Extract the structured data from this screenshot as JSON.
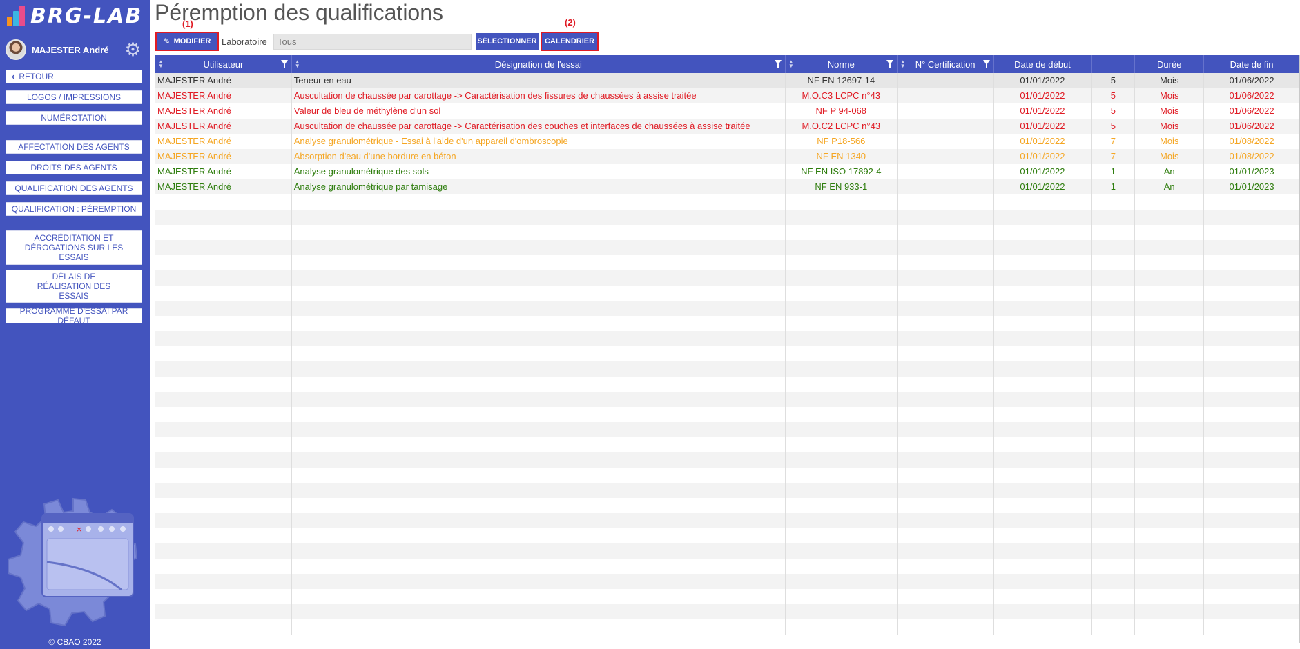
{
  "app": {
    "logo_text": "BRG-LAB",
    "copyright": "© CBAO 2022"
  },
  "colors": {
    "primary": "#4354be",
    "expired": "#e01b24",
    "warning": "#f5a623",
    "valid": "#2e7d0d",
    "callout": "#e01b24"
  },
  "user": {
    "name": "MAJESTER André"
  },
  "sidebar": {
    "back_label": "RETOUR",
    "items": [
      {
        "label": "LOGOS / IMPRESSIONS"
      },
      {
        "label": "NUMÉROTATION"
      },
      {
        "label": "AFFECTATION DES AGENTS"
      },
      {
        "label": "DROITS DES AGENTS"
      },
      {
        "label": "QUALIFICATION DES AGENTS"
      },
      {
        "label": "QUALIFICATION : PÉREMPTION"
      },
      {
        "label": "ACCRÉDITATION ET DÉROGATIONS SUR LES ESSAIS"
      },
      {
        "label": "DÉLAIS DE RÉALISATION DES ESSAIS"
      },
      {
        "label": "PROGRAMME D'ESSAI PAR DÉFAUT"
      }
    ]
  },
  "page": {
    "title": "Péremption des qualifications"
  },
  "toolbar": {
    "callout_1": "(1)",
    "callout_2": "(2)",
    "modify_label": "MODIFIER",
    "laboratory_label": "Laboratoire",
    "laboratory_placeholder": "Tous",
    "select_label": "SÉLECTIONNER",
    "calendar_label": "CALENDRIER"
  },
  "table": {
    "columns": [
      "Utilisateur",
      "Désignation de l'essai",
      "Norme",
      "N° Certification",
      "Date de début",
      "",
      "Durée",
      "Date de fin"
    ],
    "rows": [
      {
        "user": "MAJESTER André",
        "test": "Teneur en eau",
        "norm": "NF EN 12697-14",
        "cert": "",
        "start": "01/01/2022",
        "n": "5",
        "unit": "Mois",
        "end": "01/06/2022",
        "status": "gray"
      },
      {
        "user": "MAJESTER André",
        "test": "Auscultation de chaussée par carottage -> Caractérisation des fissures de chaussées à assise traitée",
        "norm": "M.O.C3 LCPC n°43",
        "cert": "",
        "start": "01/01/2022",
        "n": "5",
        "unit": "Mois",
        "end": "01/06/2022",
        "status": "red"
      },
      {
        "user": "MAJESTER André",
        "test": "Valeur de bleu de méthylène d'un sol",
        "norm": "NF P 94-068",
        "cert": "",
        "start": "01/01/2022",
        "n": "5",
        "unit": "Mois",
        "end": "01/06/2022",
        "status": "red"
      },
      {
        "user": "MAJESTER André",
        "test": "Auscultation de chaussée par carottage -> Caractérisation des couches et interfaces de chaussées à assise traitée",
        "norm": "M.O.C2 LCPC n°43",
        "cert": "",
        "start": "01/01/2022",
        "n": "5",
        "unit": "Mois",
        "end": "01/06/2022",
        "status": "red"
      },
      {
        "user": "MAJESTER André",
        "test": "Analyse granulométrique - Essai à l'aide d'un appareil d'ombroscopie",
        "norm": "NF P18-566",
        "cert": "",
        "start": "01/01/2022",
        "n": "7",
        "unit": "Mois",
        "end": "01/08/2022",
        "status": "orange"
      },
      {
        "user": "MAJESTER André",
        "test": "Absorption d'eau d'une bordure en béton",
        "norm": "NF EN 1340",
        "cert": "",
        "start": "01/01/2022",
        "n": "7",
        "unit": "Mois",
        "end": "01/08/2022",
        "status": "orange"
      },
      {
        "user": "MAJESTER André",
        "test": "Analyse granulométrique des sols",
        "norm": "NF EN ISO 17892-4",
        "cert": "",
        "start": "01/01/2022",
        "n": "1",
        "unit": "An",
        "end": "01/01/2023",
        "status": "green"
      },
      {
        "user": "MAJESTER André",
        "test": "Analyse granulométrique par tamisage",
        "norm": "NF EN 933-1",
        "cert": "",
        "start": "01/01/2022",
        "n": "1",
        "unit": "An",
        "end": "01/01/2023",
        "status": "green"
      }
    ]
  }
}
